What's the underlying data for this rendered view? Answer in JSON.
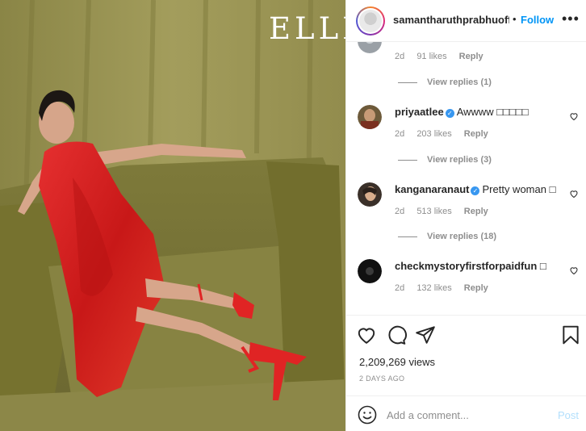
{
  "media": {
    "brand": "ELLE"
  },
  "header": {
    "username": "samantharuthprabhuoffl",
    "separator": "•",
    "follow_label": "Follow",
    "more_icon": "more-horizontal-icon"
  },
  "comments": [
    {
      "username": "",
      "verified": false,
      "text": "",
      "age": "2d",
      "likes": "91 likes",
      "reply_label": "Reply",
      "view_replies": "View replies (1)"
    },
    {
      "username": "priyaatlee",
      "verified": true,
      "text": "Awwww □□□□□",
      "age": "2d",
      "likes": "203 likes",
      "reply_label": "Reply",
      "view_replies": "View replies (3)"
    },
    {
      "username": "kanganaranaut",
      "verified": true,
      "text": "Pretty woman □",
      "age": "2d",
      "likes": "513 likes",
      "reply_label": "Reply",
      "view_replies": "View replies (18)"
    },
    {
      "username": "checkmystoryfirstforpaidfun",
      "verified": false,
      "text": "□",
      "age": "2d",
      "likes": "132 likes",
      "reply_label": "Reply"
    }
  ],
  "actions": {
    "icons": [
      "heart-icon",
      "comment-icon",
      "share-icon",
      "bookmark-icon"
    ],
    "views": "2,209,269 views",
    "posted": "2 DAYS AGO"
  },
  "add_comment": {
    "placeholder": "Add a comment...",
    "post_label": "Post"
  },
  "colors": {
    "accent": "#0095f6",
    "verified": "#3897f0",
    "post_disabled": "#b2dffc",
    "dress": "#d91f1f"
  }
}
